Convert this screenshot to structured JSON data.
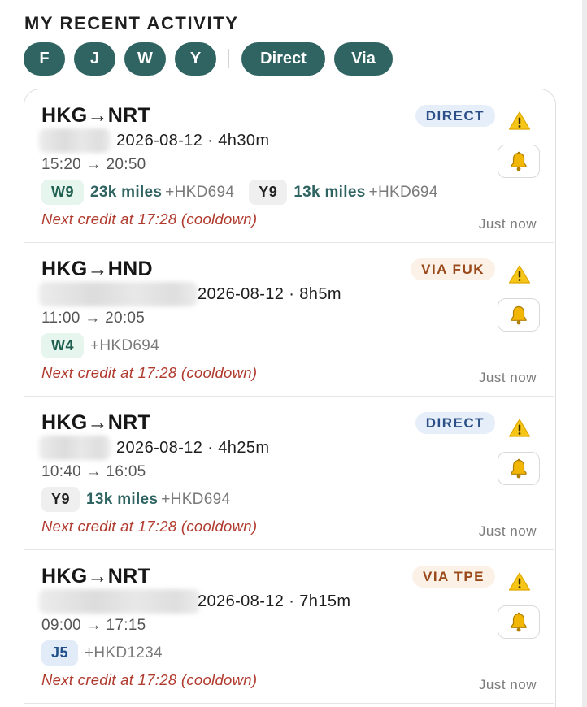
{
  "section_title": "MY RECENT ACTIVITY",
  "filters": {
    "cabins": [
      "F",
      "J",
      "W",
      "Y"
    ],
    "route_types": [
      "Direct",
      "Via"
    ]
  },
  "colors": {
    "accent": "#2f6462",
    "credit_text": "#b03a2e",
    "badge_direct_bg": "#e5eef9",
    "badge_via_bg": "#fbf1e7",
    "warning": "#f5c518"
  },
  "icons": {
    "warning": "warning-icon",
    "notify": "bell-icon"
  },
  "activities": [
    {
      "route": "HKG→NRT",
      "badge": "DIRECT",
      "date_duration": "2026-08-12 · 4h30m",
      "times": "15:20 → 20:50",
      "fares": [
        {
          "code": "W9",
          "miles": "23k miles",
          "price": "+HKD694"
        },
        {
          "code": "Y9",
          "miles": "13k miles",
          "price": "+HKD694"
        }
      ],
      "next_credit": "Next credit at 17:28 (cooldown)",
      "timestamp": "Just now"
    },
    {
      "route": "HKG→HND",
      "badge": "VIA FUK",
      "date_duration": "2026-08-12 · 8h5m",
      "times": "11:00 → 20:05",
      "fares": [
        {
          "code": "W4",
          "price": "+HKD694"
        }
      ],
      "next_credit": "Next credit at 17:28 (cooldown)",
      "timestamp": "Just now"
    },
    {
      "route": "HKG→NRT",
      "badge": "DIRECT",
      "date_duration": "2026-08-12 · 4h25m",
      "times": "10:40 → 16:05",
      "fares": [
        {
          "code": "Y9",
          "miles": "13k miles",
          "price": "+HKD694"
        }
      ],
      "next_credit": "Next credit at 17:28 (cooldown)",
      "timestamp": "Just now"
    },
    {
      "route": "HKG→NRT",
      "badge": "VIA TPE",
      "date_duration": "2026-08-12 · 7h15m",
      "times": "09:00 → 17:15",
      "fares": [
        {
          "code": "J5",
          "price": "+HKD1234"
        }
      ],
      "next_credit": "Next credit at 17:28 (cooldown)",
      "timestamp": "Just now"
    }
  ]
}
